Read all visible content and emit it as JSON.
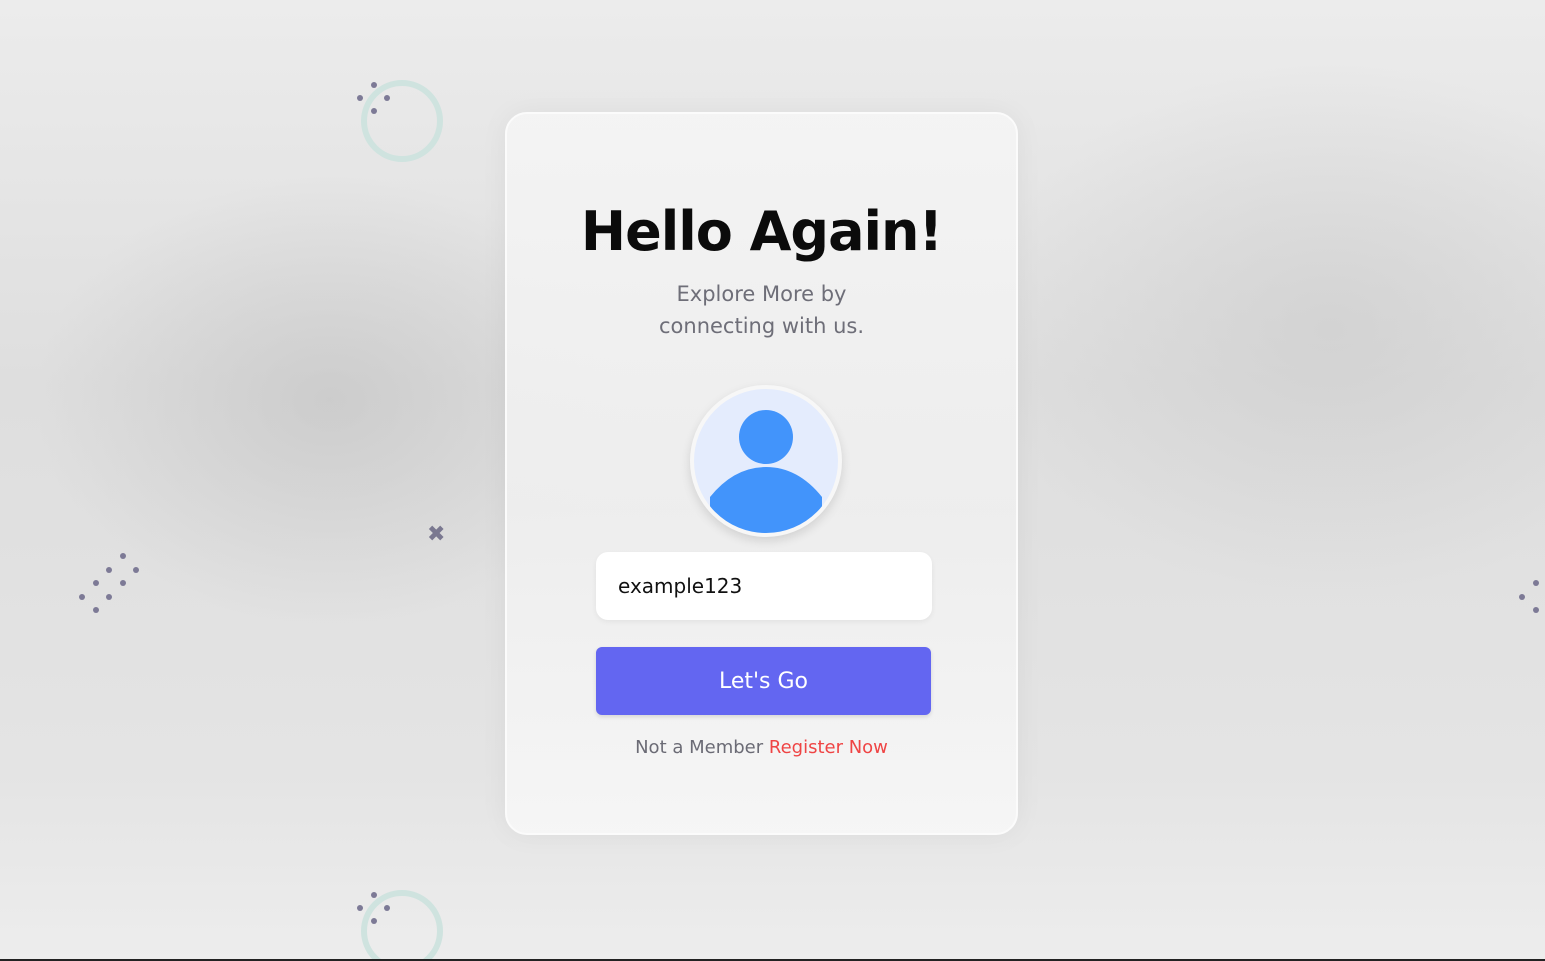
{
  "card": {
    "title": "Hello Again!",
    "subtitle_line1": "Explore More by",
    "subtitle_line2": "connecting with us.",
    "avatar_icon": "user-avatar-icon",
    "input_value": "example123",
    "button_label": "Let's Go",
    "member_text": "Not a Member",
    "register_label": "Register Now"
  },
  "colors": {
    "accent": "#6366f1",
    "link": "#ef4444",
    "avatar_fill": "#4294fb",
    "avatar_bg": "#e4ecfd",
    "ring": "#cfe3df",
    "dots": "#7d7a96"
  },
  "decorations": {
    "ring_icon": "ring-decoration",
    "dots_icon": "dot-cluster-decoration",
    "cross_icon": "cross-decoration",
    "cross_glyph": "✖"
  }
}
